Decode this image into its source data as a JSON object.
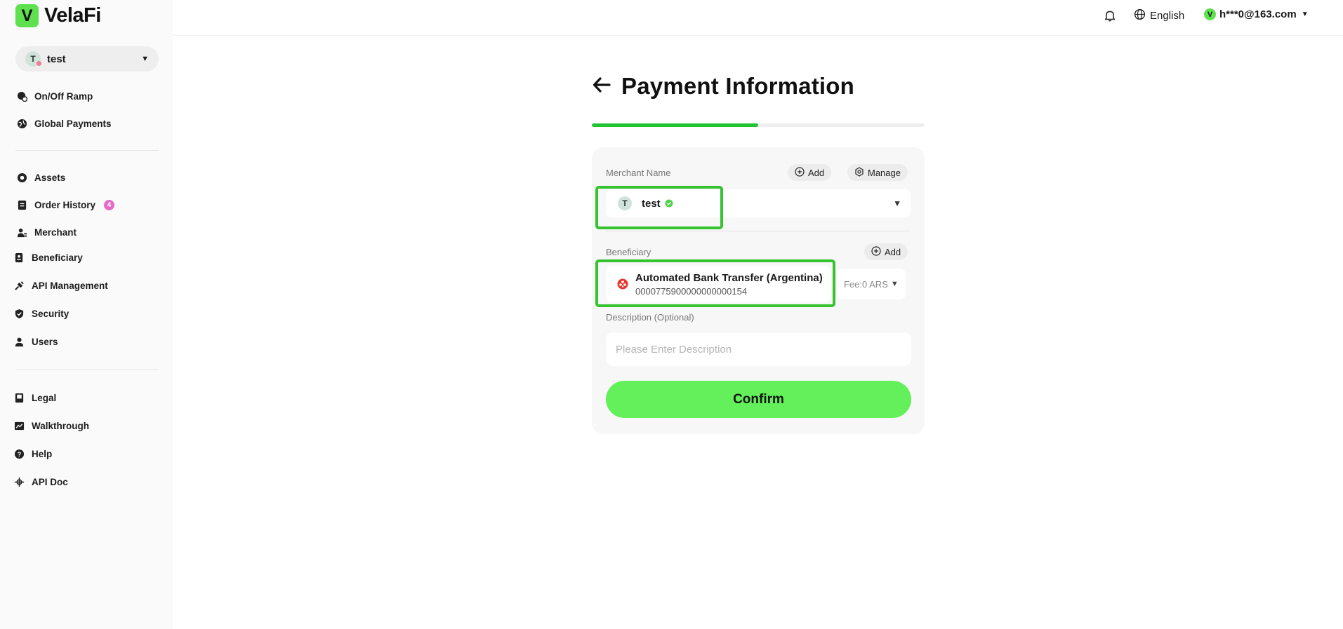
{
  "brand": {
    "logo_letter": "V",
    "name": "VelaFi",
    "accent": "#5ee04f"
  },
  "workspace": {
    "avatar": "T",
    "name": "test"
  },
  "sidebar": {
    "items": [
      {
        "label": "On/Off Ramp",
        "icon": "ramp-icon"
      },
      {
        "label": "Global Payments",
        "icon": "globe-icon"
      },
      {
        "label": "Assets",
        "icon": "coin-icon"
      },
      {
        "label": "Order History",
        "icon": "document-icon",
        "badge": "4"
      },
      {
        "label": "Merchant",
        "icon": "merchant-icon"
      },
      {
        "label": "Beneficiary",
        "icon": "beneficiary-icon"
      },
      {
        "label": "API Management",
        "icon": "api-icon"
      },
      {
        "label": "Security",
        "icon": "shield-icon"
      },
      {
        "label": "Users",
        "icon": "user-icon"
      },
      {
        "label": "Legal",
        "icon": "book-icon"
      },
      {
        "label": "Walkthrough",
        "icon": "chart-icon"
      },
      {
        "label": "Help",
        "icon": "help-icon"
      },
      {
        "label": "API Doc",
        "icon": "link-icon"
      }
    ]
  },
  "header": {
    "language": "English",
    "user_avatar": "V",
    "user_email": "h***0@163.com"
  },
  "page": {
    "title": "Payment Information",
    "progress": 0.5
  },
  "form": {
    "merchant_label": "Merchant Name",
    "add_label": "Add",
    "manage_label": "Manage",
    "merchant_avatar": "T",
    "merchant_value": "test",
    "beneficiary_label": "Beneficiary",
    "beneficiary_add_label": "Add",
    "beneficiary_name": "Automated Bank Transfer (Argentina)",
    "beneficiary_account": "0000775900000000000154",
    "fee": "Fee:0 ARS",
    "description_label": "Description (Optional)",
    "description_placeholder": "Please Enter Description",
    "confirm_label": "Confirm"
  }
}
